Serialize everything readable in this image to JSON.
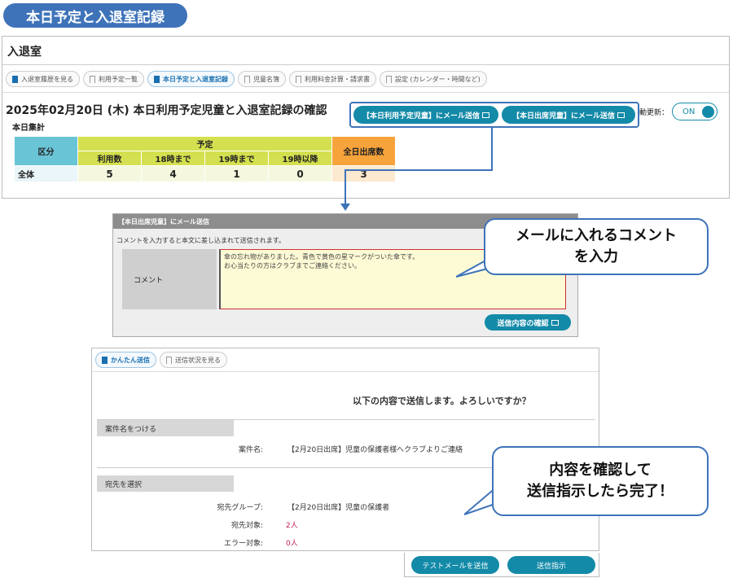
{
  "title_pill": "本日予定と入退室記録",
  "panel1": {
    "heading": "入退室",
    "tabs": [
      {
        "label": "入退室履歴を見る",
        "active": false,
        "icon": "bookmark-filled-icon"
      },
      {
        "label": "利用予定一覧",
        "active": false,
        "icon": "bookmark-icon"
      },
      {
        "label": "本日予定と入退室記録",
        "active": true,
        "icon": "bookmark-filled-icon"
      },
      {
        "label": "児童名簿",
        "active": false,
        "icon": "bookmark-icon"
      },
      {
        "label": "利用料金計算・請求書",
        "active": false,
        "icon": "bookmark-icon"
      },
      {
        "label": "設定 (カレンダー・時間など)",
        "active": false,
        "icon": "bookmark-icon"
      }
    ],
    "date_title": "2025年02月20日 (木) 本日利用予定児童と入退室記録の確認",
    "summary_label": "本日集計",
    "mail_buttons": [
      "【本日利用予定児童】にメール送信",
      "【本日出席児童】にメール送信"
    ],
    "auto_update_label": "動更新：",
    "toggle_label": "ON",
    "table": {
      "col_category": "区分",
      "col_group": "予定",
      "sub_cols": [
        "利用数",
        "18時まで",
        "19時まで",
        "19時以降"
      ],
      "col_all": "全日出席数",
      "rows": [
        {
          "label": "全体",
          "values": [
            "5",
            "4",
            "1",
            "0"
          ],
          "all": "3"
        }
      ]
    }
  },
  "panel2": {
    "header": "【本日出席児童】にメール送信",
    "description": "コメントを入力すると本文に差し込まれて送信されます。",
    "comment_label": "コメント",
    "comment_line1": "傘の忘れ物がありました。青色で黄色の星マークがついた傘です。",
    "comment_line2": "お心当たりの方はクラブまでご連絡ください。",
    "confirm_button": "送信内容の確認"
  },
  "panel3": {
    "tabs": [
      {
        "label": "かんたん送信",
        "active": true
      },
      {
        "label": "送信状況を見る",
        "active": false
      }
    ],
    "confirm_question": "以下の内容で送信します。よろしいですか？",
    "section_subject": "案件名をつける",
    "subject_label": "案件名:",
    "subject_value": "【2月20日出席】児童の保護者様へクラブよりご連絡",
    "section_recipient": "宛先を選択",
    "group_label": "宛先グループ:",
    "group_value": "【2月20日出席】児童の保護者",
    "target_label": "宛先対象:",
    "target_value": "2人",
    "error_label": "エラー対象:",
    "error_value": "0人",
    "test_button": "テストメールを送信",
    "send_button": "送信指示"
  },
  "callouts": {
    "comment": "メールに入れるコメント\nを入力",
    "complete": "内容を確認して\n送信指示したら完了！"
  },
  "colors": {
    "accent_blue": "#3e73b9",
    "teal_button": "#138aa8",
    "header_cyan": "#69c4d6",
    "header_yellow": "#d4e04f",
    "header_orange": "#f7a33b"
  }
}
